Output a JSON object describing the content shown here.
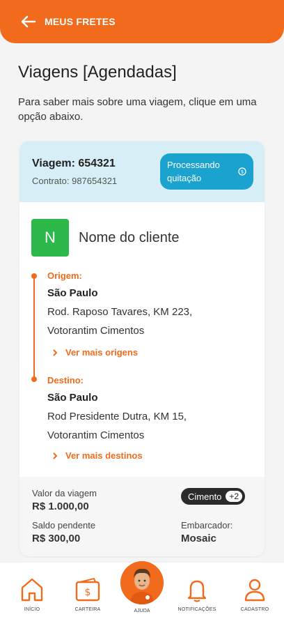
{
  "header": {
    "back_label": "MEUS FRETES"
  },
  "page": {
    "title": "Viagens [Agendadas]",
    "subtitle": "Para saber mais sobre uma viagem, clique em uma opção abaixo."
  },
  "trip": {
    "id": "Viagem: 654321",
    "contract": "Contrato: 987654321",
    "status_line1": "Processando",
    "status_line2": "quitação",
    "client_initial": "N",
    "client_name": "Nome do cliente",
    "origin": {
      "label": "Origem:",
      "city": "São Paulo",
      "address_line1": "Rod. Raposo Tavares, KM 223,",
      "address_line2": "Votorantim Cimentos",
      "more": "Ver mais origens"
    },
    "destination": {
      "label": "Destino:",
      "city": "São Paulo",
      "address_line1": "Rod Presidente Dutra, KM 15,",
      "address_line2": "Votorantim Cimentos",
      "more": "Ver mais destinos"
    },
    "value_label": "Valor da viagem",
    "value": "R$ 1.000,00",
    "pending_label": "Saldo pendente",
    "pending": "R$ 300,00",
    "cargo_tag": "Cimento",
    "cargo_extra": "+2",
    "shipper_label": "Embarcador:",
    "shipper": "Mosaic"
  },
  "nav": {
    "home": "INÍCIO",
    "wallet": "CARTEIRA",
    "help": "AJUDA",
    "notifications": "NOTIFICAÇÕES",
    "profile": "CADASTRO"
  },
  "colors": {
    "accent": "#f26a1b",
    "status": "#1aa3cf",
    "header_bg": "#d8eef6",
    "avatar": "#2db84a"
  }
}
